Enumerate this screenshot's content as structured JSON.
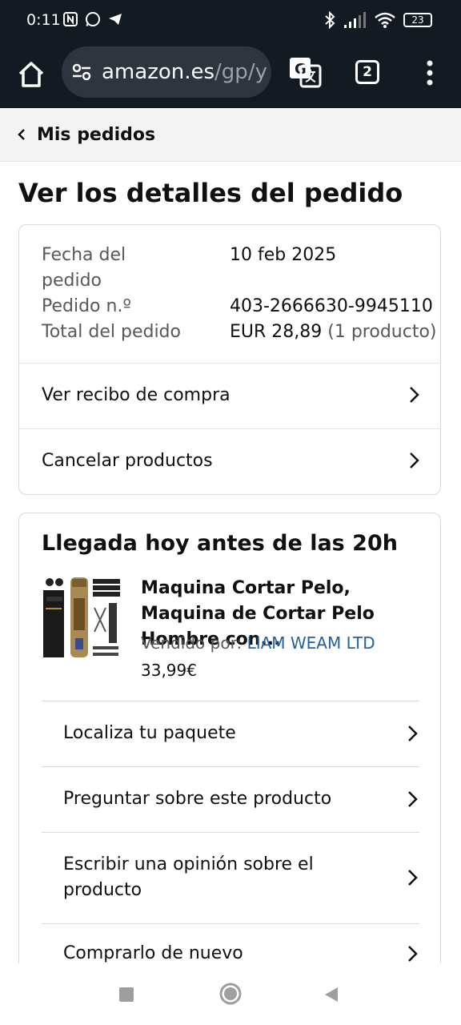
{
  "status_bar": {
    "time": "0:11",
    "battery": "23"
  },
  "browser": {
    "url_domain": "amazon.es",
    "url_path": "/gp/y",
    "tab_count": "2"
  },
  "breadcrumb": {
    "label": "Mis pedidos"
  },
  "page": {
    "title": "Ver los detalles del pedido"
  },
  "order_summary": {
    "date_label": "Fecha del pedido",
    "date_value": "10 feb 2025",
    "number_label": "Pedido n.º",
    "number_value": "403-2666630-9945110",
    "total_label": "Total del pedido",
    "total_value": "EUR 28,89",
    "total_count": "(1 producto)",
    "receipt_link": "Ver recibo de compra",
    "cancel_link": "Cancelar productos"
  },
  "shipment": {
    "heading": "Llegada hoy antes de las 20h",
    "product_title": "Maquina Cortar Pelo, Maquina de Cortar Pelo Hombre con...",
    "seller_prefix": "Vendido por:",
    "seller_name": "LIAM WEAM LTD",
    "price": "33,99€",
    "actions": [
      {
        "label": "Localiza tu paquete"
      },
      {
        "label": "Preguntar sobre este producto"
      },
      {
        "label": "Escribir una opinión sobre el producto"
      },
      {
        "label": "Comprarlo de nuevo"
      }
    ]
  }
}
